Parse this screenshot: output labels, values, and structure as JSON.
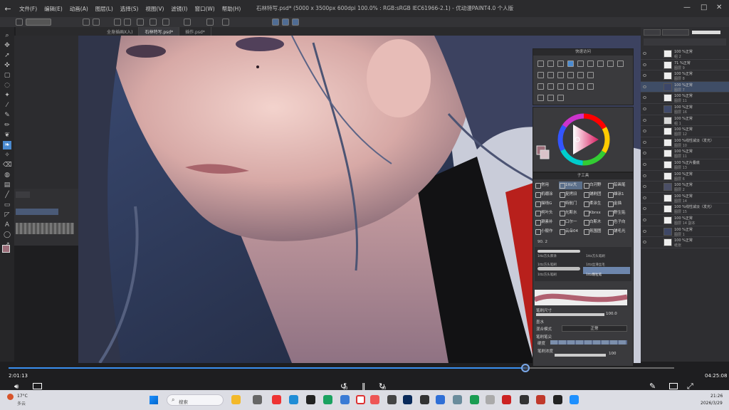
{
  "menubar": {
    "items": [
      "文件(F)",
      "编辑(E)",
      "动画(A)",
      "图层(L)",
      "选择(S)",
      "视图(V)",
      "滤镜(I)",
      "窗口(W)",
      "帮助(H)"
    ],
    "window_title": "石林特写.psd* (5000 x 3500px 600dpi 100.0% : RGB:sRGB IEC61966-2.1) - 优动漫PAINT4.0 个人版"
  },
  "tabs": [
    "全身插画X入)",
    "石林特写.psd*",
    "插作.psd*"
  ],
  "panels": {
    "quick_access_title": "快速访问",
    "subtool_title": "子工具",
    "brushes": [
      [
        "常用",
        "1ttz大",
        "白河野",
        "铅画笔"
      ],
      [
        "机绷涂",
        "复拷旧",
        "铺刷团",
        "雄涂1"
      ],
      [
        "描线G",
        "特航门",
        "柔涂生",
        "金描"
      ],
      [
        "柯叶头",
        "光斯水",
        "Kbrxx",
        "野生贴"
      ],
      [
        "涮素补",
        "口尔一",
        "白斯木",
        "色子向"
      ],
      [
        "小舰作",
        "云朵04",
        "氛围图",
        "铺毛光"
      ]
    ],
    "brush_group": "90. 2",
    "brush_strokes": [
      "1ttz方头厚涂",
      "1ttz方头笔刷",
      "1ttz方头笔刷",
      "1ttz丝滑丝毛",
      "1ttz方头笔刷",
      "1ttz颗粒笔"
    ],
    "brush_size_label": "笔刷尺寸",
    "brush_size_value": "100.0",
    "ink_label": "墨水",
    "blend_mode_label": "混合模式",
    "blend_mode_value": "正常",
    "brush_shape_label": "笔刷笔尖",
    "density_label": "硬度",
    "density2_label": "笔刷浓度",
    "density2_value": "100"
  },
  "color": {
    "main": "#9c6d79",
    "sub": "#d9c3c8"
  },
  "layers": [
    {
      "t1": "100 %正常",
      "t2": "组 2"
    },
    {
      "t1": "71 %正常",
      "t2": "图层 9"
    },
    {
      "t1": "100 %正常",
      "t2": "图层 8"
    },
    {
      "t1": "100 %正常",
      "t2": "图层 7"
    },
    {
      "t1": "100 %正常",
      "t2": "图层 11"
    },
    {
      "t1": "100 %正常",
      "t2": "图层 16"
    },
    {
      "t1": "100 %正常",
      "t2": "组 1"
    },
    {
      "t1": "100 %正常",
      "t2": "图层 12"
    },
    {
      "t1": "100 %线性减淡（发光）",
      "t2": "图层 10"
    },
    {
      "t1": "100 %正常",
      "t2": "图层 11"
    },
    {
      "t1": "100 %正片叠底",
      "t2": "图层 13"
    },
    {
      "t1": "100 %正常",
      "t2": "图层 6"
    },
    {
      "t1": "100 %正常",
      "t2": "图层 2"
    },
    {
      "t1": "100 %正常",
      "t2": "图层 14"
    },
    {
      "t1": "100 %线性减淡（发光）",
      "t2": "图层 15"
    },
    {
      "t1": "100 %正常",
      "t2": "图层 14 副本"
    },
    {
      "t1": "100 %正常",
      "t2": "图层 1"
    },
    {
      "t1": "100 %正常",
      "t2": "纸张"
    }
  ],
  "video": {
    "current_time": "2:01:13",
    "total_time": "04:25:08",
    "skip_back": "10",
    "skip_forward": "30",
    "progress": 0.777
  },
  "taskbar": {
    "weather_temp": "17°C",
    "weather_desc": "多云",
    "search_placeholder": "搜索",
    "time": "21:26",
    "date": "2026/3/29"
  }
}
